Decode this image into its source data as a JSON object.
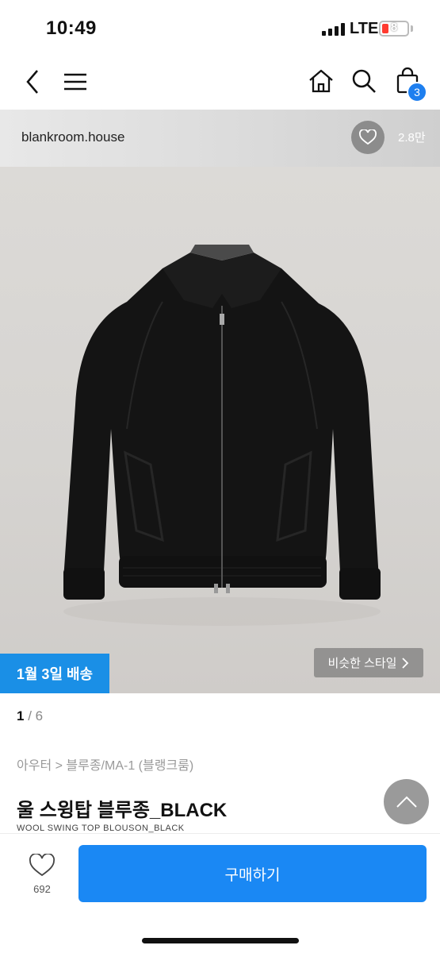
{
  "status": {
    "time": "10:49",
    "network": "LTE",
    "battery": "8"
  },
  "nav": {
    "cart_count": "3"
  },
  "store": {
    "name": "blankroom.house",
    "likes": "2.8만"
  },
  "image": {
    "delivery_badge": "1월 3일 배송",
    "similar_style": "비슷한 스타일",
    "page_current": "1",
    "page_total": "/ 6"
  },
  "product": {
    "breadcrumb": "아우터 > 블루종/MA-1 (블랭크룸)",
    "title": "울 스윙탑 블루종_BLACK",
    "subtitle": "WOOL SWING TOP BLOUSON_BLACK"
  },
  "bottom": {
    "wish_count": "692",
    "buy_label": "구매하기"
  },
  "colors": {
    "accent": "#1a88f4",
    "badge": "#1a8fe6",
    "cart_badge": "#1e7fef"
  }
}
